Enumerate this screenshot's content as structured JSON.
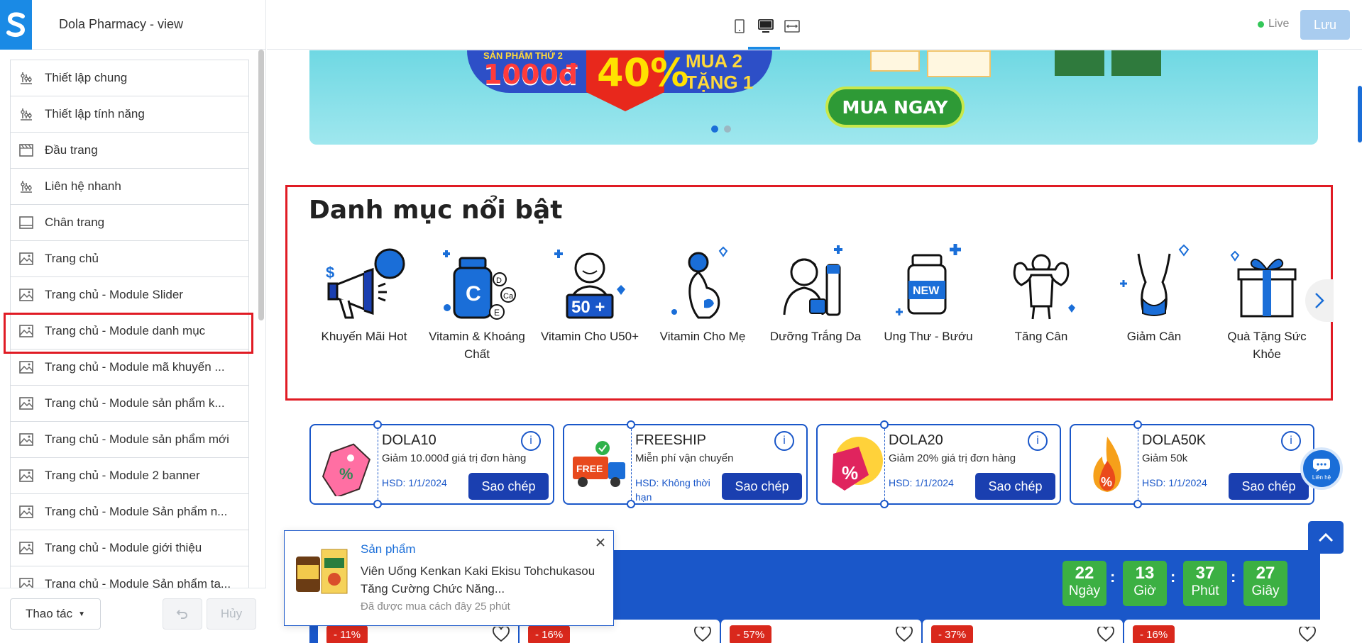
{
  "app": {
    "theme_title": "Dola Pharmacy - view",
    "live_label": "Live",
    "save_label": "Lưu",
    "actions_label": "Thao tác",
    "cancel_label": "Hủy"
  },
  "sidebar": {
    "items": [
      {
        "label": "Thiết lập chung",
        "icon": "settings-sliders-icon"
      },
      {
        "label": "Thiết lập tính năng",
        "icon": "settings-sliders-icon"
      },
      {
        "label": "Đầu trang",
        "icon": "header-layout-icon"
      },
      {
        "label": "Liên hệ nhanh",
        "icon": "settings-sliders-icon"
      },
      {
        "label": "Chân trang",
        "icon": "footer-layout-icon"
      },
      {
        "label": "Trang chủ",
        "icon": "image-section-icon"
      },
      {
        "label": "Trang chủ - Module Slider",
        "icon": "image-section-icon"
      },
      {
        "label": "Trang chủ - Module danh mục",
        "icon": "image-section-icon",
        "selected": true
      },
      {
        "label": "Trang chủ - Module mã khuyến ...",
        "icon": "image-section-icon"
      },
      {
        "label": "Trang chủ - Module sản phẩm k...",
        "icon": "image-section-icon"
      },
      {
        "label": "Trang chủ - Module sản phẩm mới",
        "icon": "image-section-icon"
      },
      {
        "label": "Trang chủ - Module 2 banner",
        "icon": "image-section-icon"
      },
      {
        "label": "Trang chủ - Module Sản phẩm n...",
        "icon": "image-section-icon"
      },
      {
        "label": "Trang chủ - Module giới thiệu",
        "icon": "image-section-icon"
      },
      {
        "label": "Trang chủ - Module Sản phẩm ta...",
        "icon": "image-section-icon"
      }
    ]
  },
  "banner": {
    "promo_small": "SẢN PHẨM THỨ 2",
    "promo_price": "1000đ",
    "promo_percent": "40%",
    "promo_right": "MUA 2 TẶNG 1",
    "cta": "MUA NGAY"
  },
  "categories": {
    "title": "Danh mục nổi bật",
    "items": [
      {
        "label": "Khuyến Mãi Hot",
        "icon": "megaphone-icon"
      },
      {
        "label": "Vitamin & Khoáng Chất",
        "icon": "vitamin-bottle-icon"
      },
      {
        "label": "Vitamin Cho U50+",
        "icon": "elderly-icon"
      },
      {
        "label": "Vitamin Cho Mẹ",
        "icon": "pregnant-icon"
      },
      {
        "label": "Dưỡng Trắng Da",
        "icon": "skincare-icon"
      },
      {
        "label": "Ung Thư - Bướu",
        "icon": "medicine-jar-icon"
      },
      {
        "label": "Tăng Cân",
        "icon": "muscle-icon"
      },
      {
        "label": "Giảm Cân",
        "icon": "body-slim-icon"
      },
      {
        "label": "Quà Tặng Sức Khỏe",
        "icon": "gift-icon"
      }
    ]
  },
  "coupons": [
    {
      "code": "DOLA10",
      "desc": "Giảm 10.000đ giá trị đơn hàng",
      "expiry": "HSD: 1/1/2024",
      "copy": "Sao chép",
      "icon": "tag-icon"
    },
    {
      "code": "FREESHIP",
      "desc": "Miễn phí vận chuyển",
      "expiry": "HSD: Không thời hạn",
      "copy": "Sao chép",
      "icon": "truck-icon"
    },
    {
      "code": "DOLA20",
      "desc": "Giảm 20% giá trị đơn hàng",
      "expiry": "HSD: 1/1/2024",
      "copy": "Sao chép",
      "icon": "percent-tag-icon"
    },
    {
      "code": "DOLA50K",
      "desc": "Giảm 50k",
      "expiry": "HSD: 1/1/2024",
      "copy": "Sao chép",
      "icon": "fire-icon"
    }
  ],
  "chat": {
    "label": "Liên hệ"
  },
  "countdown": [
    {
      "value": "22",
      "label": "Ngày"
    },
    {
      "value": "13",
      "label": "Giờ"
    },
    {
      "value": "37",
      "label": "Phút"
    },
    {
      "value": "27",
      "label": "Giây"
    }
  ],
  "products": [
    {
      "discount": "- 11%"
    },
    {
      "discount": "- 16%"
    },
    {
      "discount": "- 57%"
    },
    {
      "discount": "- 37%"
    },
    {
      "discount": "- 16%"
    }
  ],
  "toast": {
    "type": "Sản phẩm",
    "name": "Viên Uống Kenkan Kaki Ekisu Tohchukasou Tăng Cường Chức Năng...",
    "time": "Đã được mua cách đây 25 phút"
  },
  "colors": {
    "primary": "#1a57c9",
    "accent": "#1a8ae5",
    "highlight": "#e01b24",
    "green": "#3cb043"
  }
}
